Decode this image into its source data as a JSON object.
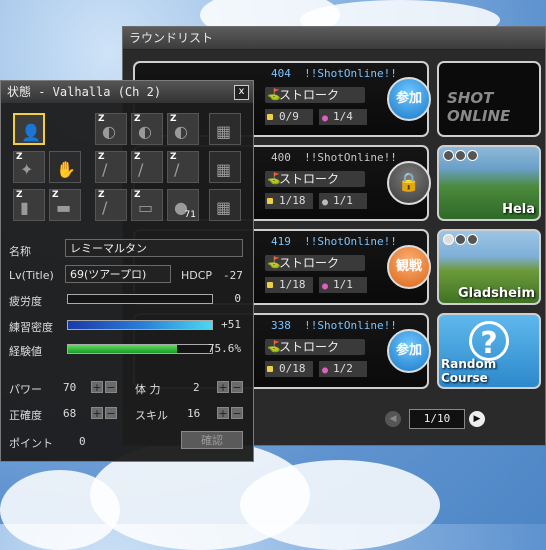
{
  "round_list": {
    "title": "ラウンドリスト",
    "rooms": [
      {
        "number": "404",
        "name": "!!ShotOnline!!",
        "mode": "ストローク",
        "holes": "0/9",
        "players": "1/4",
        "button": "参加",
        "button_type": "join",
        "number_color": "#7ac3ff"
      },
      {
        "number": "400",
        "name": "!!ShotOnline!!",
        "mode": "ストローク",
        "holes": "1/18",
        "players": "1/1",
        "button": "",
        "button_type": "lock",
        "number_color": "#c8c8c8"
      },
      {
        "number": "419",
        "name": "!!ShotOnline!!",
        "mode": "ストローク",
        "holes": "1/18",
        "players": "1/1",
        "button": "観戦",
        "button_type": "watch",
        "number_color": "#7ac3ff"
      },
      {
        "number": "338",
        "name": "!!ShotOnline!!",
        "mode": "ストローク",
        "holes": "0/18",
        "players": "1/2",
        "button": "参加",
        "button_type": "join",
        "number_color": "#7ac3ff"
      }
    ],
    "courses": [
      "",
      "Hela",
      "Gladsheim",
      "Random Course"
    ],
    "logo_text": "SHOT ONLINE",
    "page": "1/10"
  },
  "status": {
    "title": "状態 -  Valhalla (Ch 2)",
    "close": "x",
    "equipment": [
      {
        "row": 0,
        "col": 0,
        "z": "",
        "icon": "👤",
        "count": "",
        "selected": true
      },
      {
        "row": 0,
        "col": 2,
        "z": "Z",
        "icon": "◐",
        "count": ""
      },
      {
        "row": 0,
        "col": 3,
        "z": "Z",
        "icon": "◐",
        "count": ""
      },
      {
        "row": 0,
        "col": 4,
        "z": "Z",
        "icon": "◐",
        "count": ""
      },
      {
        "row": 0,
        "col": 5,
        "z": "",
        "icon": "▦",
        "count": "",
        "empty": true
      },
      {
        "row": 1,
        "col": 0,
        "z": "Z",
        "icon": "✦",
        "count": ""
      },
      {
        "row": 1,
        "col": 1,
        "z": "",
        "icon": "✋",
        "count": "",
        "empty": true
      },
      {
        "row": 1,
        "col": 2,
        "z": "Z",
        "icon": "/",
        "count": ""
      },
      {
        "row": 1,
        "col": 3,
        "z": "Z",
        "icon": "/",
        "count": ""
      },
      {
        "row": 1,
        "col": 4,
        "z": "Z",
        "icon": "/",
        "count": ""
      },
      {
        "row": 1,
        "col": 5,
        "z": "",
        "icon": "▦",
        "count": "",
        "empty": true
      },
      {
        "row": 2,
        "col": 0,
        "z": "Z",
        "icon": "▮",
        "count": ""
      },
      {
        "row": 2,
        "col": 1,
        "z": "Z",
        "icon": "▬",
        "count": ""
      },
      {
        "row": 2,
        "col": 2,
        "z": "Z",
        "icon": "/",
        "count": ""
      },
      {
        "row": 2,
        "col": 3,
        "z": "Z",
        "icon": "▭",
        "count": ""
      },
      {
        "row": 2,
        "col": 4,
        "z": "",
        "icon": "●",
        "count": "71"
      },
      {
        "row": 2,
        "col": 5,
        "z": "",
        "icon": "▦",
        "count": "",
        "empty": true
      }
    ],
    "name_label": "名称",
    "name_value": "レミーマルタン",
    "level_label": "Lv(Title)",
    "level_value": "69(ツアープロ)",
    "hdcp_label": "HDCP",
    "hdcp_value": "-27",
    "fatigue_label": "疲労度",
    "fatigue_value": "0",
    "practice_label": "練習密度",
    "practice_value": "+51",
    "exp_label": "経験値",
    "exp_value": "75.6%",
    "power_label": "パワー",
    "power_value": "70",
    "stamina_label": "体 力",
    "stamina_value": "2",
    "accuracy_label": "正確度",
    "accuracy_value": "68",
    "skill_label": "スキル",
    "skill_value": "16",
    "points_label": "ポイント",
    "points_value": "0",
    "confirm_label": "確認",
    "plus": "+",
    "minus": "−"
  }
}
